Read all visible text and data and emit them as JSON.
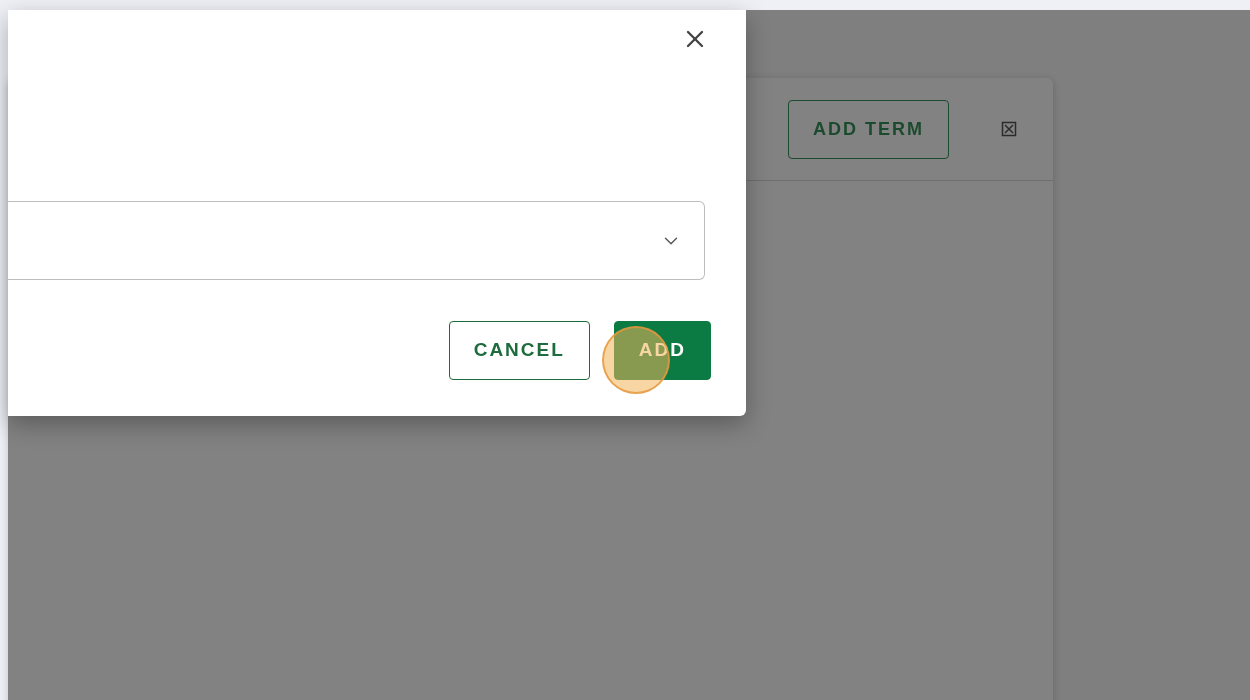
{
  "background_card": {
    "header_button": "ADD TERM"
  },
  "dialog": {
    "buttons": [
      {
        "label": "CANCEL",
        "kind": "outlined"
      },
      {
        "label": "ADD",
        "kind": "filled"
      }
    ]
  }
}
